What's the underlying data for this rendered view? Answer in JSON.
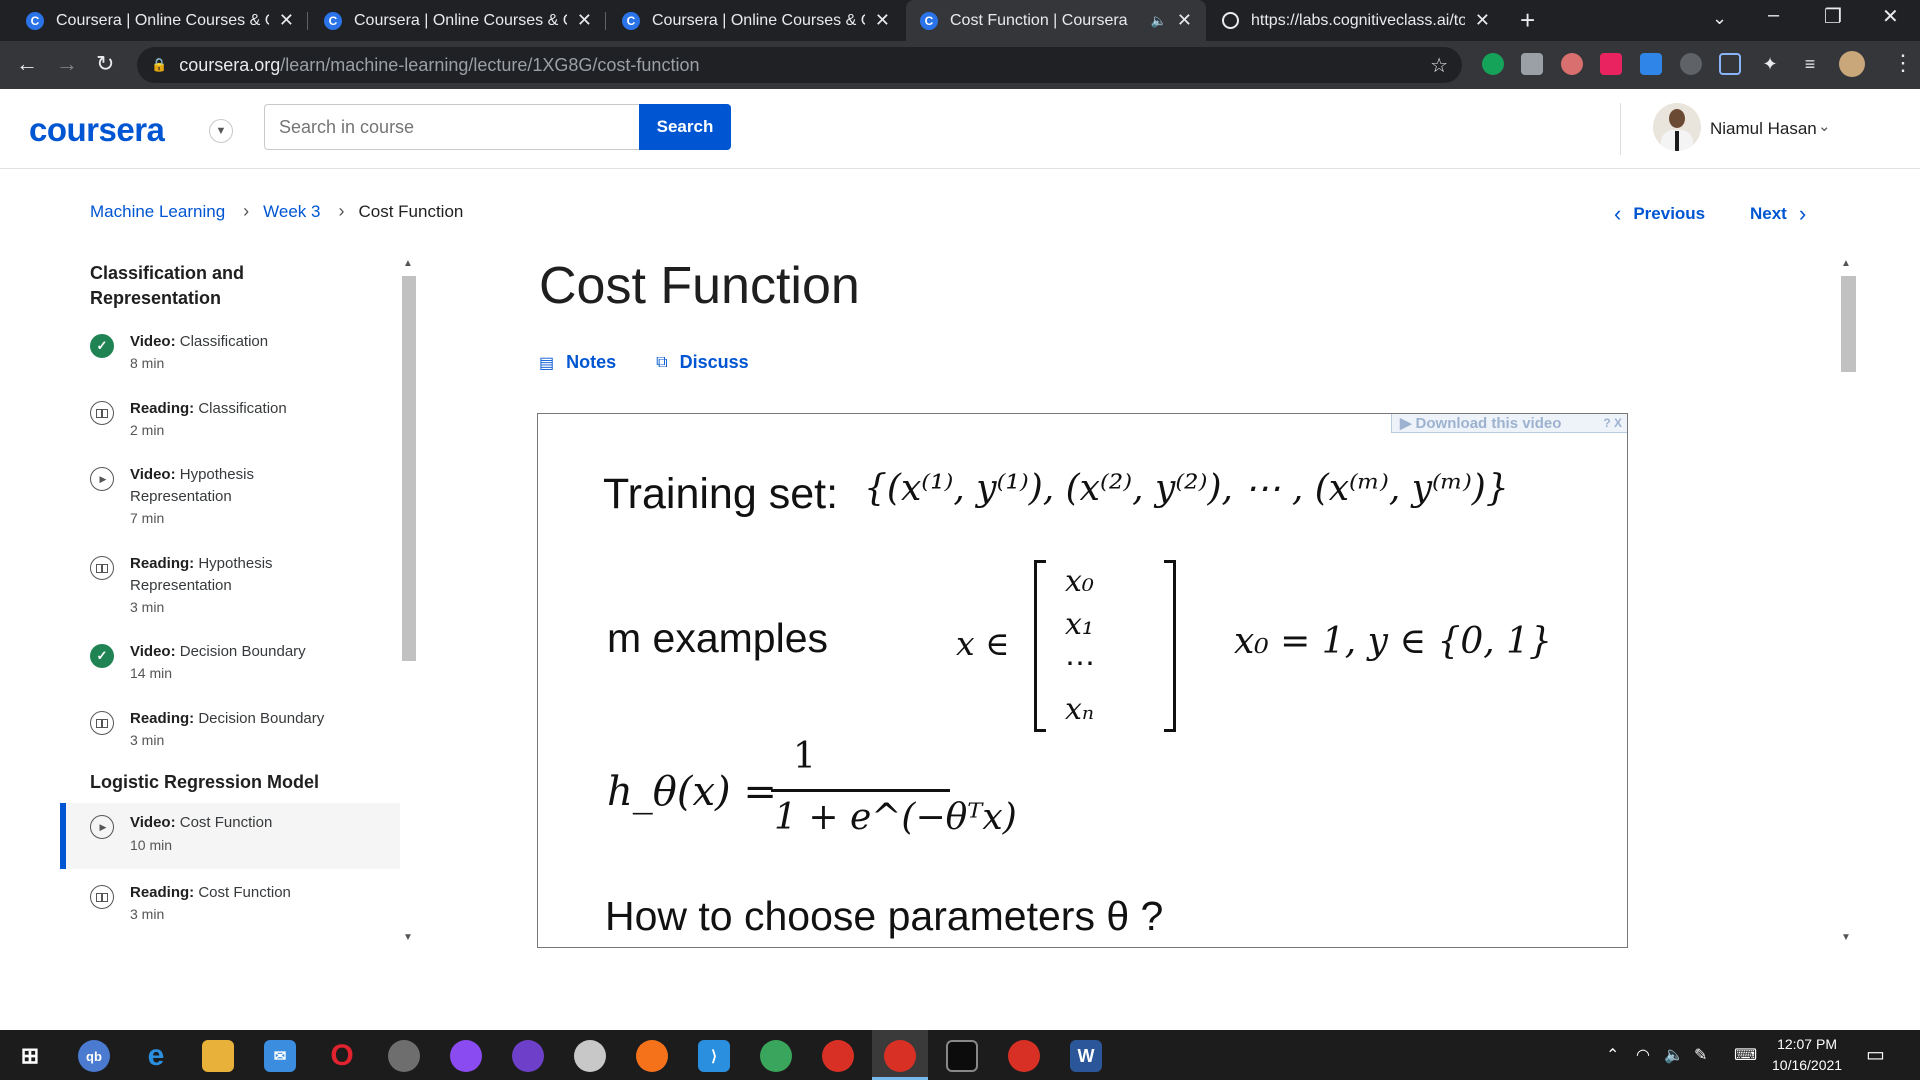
{
  "browser": {
    "tabs": [
      {
        "title": "Coursera | Online Courses & Credentials",
        "favicon": "coursera-icon",
        "active": false
      },
      {
        "title": "Coursera | Online Courses & Credentials",
        "favicon": "coursera-icon",
        "active": false
      },
      {
        "title": "Coursera | Online Courses & Credentials",
        "favicon": "coursera-icon",
        "active": false
      },
      {
        "title": "Cost Function | Coursera",
        "favicon": "coursera-icon",
        "active": true,
        "audio": true
      },
      {
        "title": "https://labs.cognitiveclass.ai/tools",
        "favicon": "globe-icon",
        "active": false
      }
    ],
    "url_domain": "coursera.org",
    "url_path": "/learn/machine-learning/lecture/1XG8G/cost-function"
  },
  "header": {
    "logo": "coursera",
    "search_placeholder": "Search in course",
    "search_button": "Search",
    "user_name": "Niamul Hasan"
  },
  "breadcrumb": {
    "items": [
      "Machine Learning",
      "Week 3"
    ],
    "current": "Cost Function"
  },
  "nav": {
    "previous": "Previous",
    "next": "Next"
  },
  "sidebar": {
    "sections": [
      {
        "title_line1": "Classification and",
        "title_line2": "Representation",
        "items": [
          {
            "kind": "Video:",
            "name": "Classification",
            "duration": "8 min",
            "status": "completed"
          },
          {
            "kind": "Reading:",
            "name": "Classification",
            "duration": "2 min",
            "status": "reading"
          },
          {
            "kind": "Video:",
            "name": "Hypothesis",
            "name2": "Representation",
            "duration": "7 min",
            "status": "video"
          },
          {
            "kind": "Reading:",
            "name": "Hypothesis",
            "name2": "Representation",
            "duration": "3 min",
            "status": "reading"
          },
          {
            "kind": "Video:",
            "name": "Decision Boundary",
            "duration": "14 min",
            "status": "completed"
          },
          {
            "kind": "Reading:",
            "name": "Decision Boundary",
            "duration": "3 min",
            "status": "reading"
          }
        ]
      },
      {
        "title": "Logistic Regression Model",
        "items": [
          {
            "kind": "Video:",
            "name": "Cost Function",
            "duration": "10 min",
            "status": "video",
            "active": true
          },
          {
            "kind": "Reading:",
            "name": "Cost Function",
            "duration": "3 min",
            "status": "reading"
          }
        ]
      }
    ]
  },
  "content": {
    "title": "Cost Function",
    "notes_label": "Notes",
    "discuss_label": "Discuss",
    "download_label": "Download this video",
    "download_help": "? X"
  },
  "slide": {
    "training_label": "Training set:",
    "training_set": "{(x⁽¹⁾, y⁽¹⁾), (x⁽²⁾, y⁽²⁾), ⋯ , (x⁽ᵐ⁾, y⁽ᵐ⁾)}",
    "examples_label": "m examples",
    "x_in": "x ∈",
    "vector": [
      "x₀",
      "x₁",
      "⋯",
      "xₙ"
    ],
    "constraints": "x₀ = 1, y ∈ {0, 1}",
    "hypothesis_lhs": "h_θ(x) =",
    "hypothesis_num": "1",
    "hypothesis_den": "1 + e^(−θᵀx)",
    "question": "How to choose parameters θ ?"
  },
  "taskbar": {
    "time": "12:07 PM",
    "date": "10/16/2021"
  },
  "colors": {
    "accent": "#0056d2",
    "completed": "#1f8354",
    "chrome_dark": "#202124",
    "chrome_toolbar": "#35363a"
  }
}
